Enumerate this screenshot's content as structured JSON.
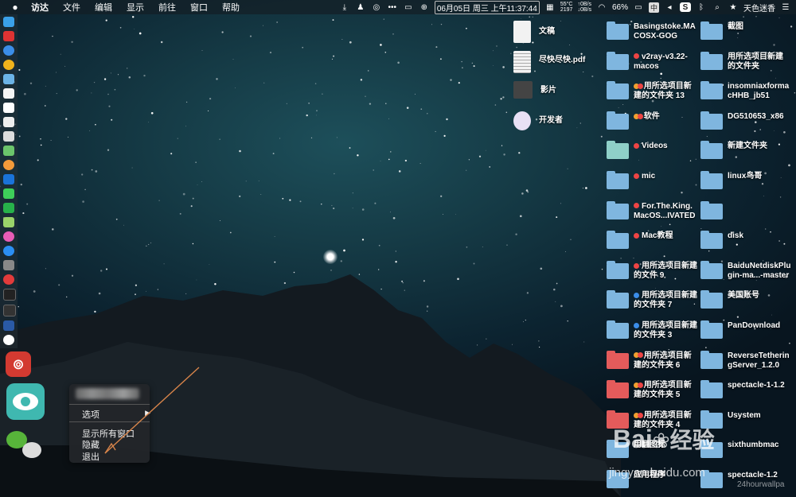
{
  "menubar": {
    "app_name": "访达",
    "menus": [
      "文件",
      "编辑",
      "显示",
      "前往",
      "窗口",
      "帮助"
    ],
    "cpu_temp": "55°C",
    "cpu_rpm": "2197",
    "net_up": "↑0B/s",
    "net_down": "↓0B/s",
    "datetime": "06月05日 周三 上午11:37:44",
    "battery": "66%",
    "input_method": "中",
    "user": "天色迷香"
  },
  "context_menu": {
    "options_label": "选项",
    "show_all_windows": "显示所有窗口",
    "hide": "隐藏",
    "quit": "退出"
  },
  "desktop_files": [
    {
      "label": "文稿"
    },
    {
      "label": "尽快尽快.pdf"
    },
    {
      "label": "影片"
    },
    {
      "label": "开发者"
    }
  ],
  "desktop_folders_col1": [
    {
      "l1": "Basingstoke.MA",
      "l2": "COSX-GOG"
    },
    {
      "l1": "v2ray-v3.22-",
      "l2": "macos"
    },
    {
      "l1": "用所选项目新",
      "l2": "建的文件夹 13"
    },
    {
      "l1": "软件",
      "l2": ""
    },
    {
      "l1": "Videos",
      "l2": ""
    },
    {
      "l1": "mic",
      "l2": ""
    },
    {
      "l1": "For.The.King.",
      "l2": "MacOS...IVATED"
    },
    {
      "l1": "Mac教程",
      "l2": ""
    },
    {
      "l1": "用所选项目新建",
      "l2": "的文件 9"
    },
    {
      "l1": "用所选项目新建",
      "l2": "的文件夹 7"
    },
    {
      "l1": "用所选项目新建",
      "l2": "的文件夹 3"
    },
    {
      "l1": "用所选项目新",
      "l2": "建的文件夹 6"
    },
    {
      "l1": "用所选项目新",
      "l2": "建的文件夹 5"
    },
    {
      "l1": "用所选项目新",
      "l2": "建的文件夹 4"
    },
    {
      "l1": "用翻图标",
      "l2": ""
    },
    {
      "l1": "应用程序",
      "l2": ""
    }
  ],
  "desktop_folders_col2": [
    {
      "l1": "截图",
      "l2": ""
    },
    {
      "l1": "用所选项目新建",
      "l2": "的文件夹"
    },
    {
      "l1": "insomniaxforma",
      "l2": "cHHB_jb51"
    },
    {
      "l1": "DG510653_x86",
      "l2": ""
    },
    {
      "l1": "新建文件夹",
      "l2": ""
    },
    {
      "l1": "linux鸟哥",
      "l2": ""
    },
    {
      "l1": "",
      "l2": ""
    },
    {
      "l1": "disk",
      "l2": ""
    },
    {
      "l1": "BaiduNetdiskPlu",
      "l2": "gin-ma...-master"
    },
    {
      "l1": "美国账号",
      "l2": ""
    },
    {
      "l1": "PanDownload",
      "l2": ""
    },
    {
      "l1": "ReverseTetherin",
      "l2": "gServer_1.2.0"
    },
    {
      "l1": "spectacle-1-1.2",
      "l2": ""
    },
    {
      "l1": "Usystem",
      "l2": ""
    },
    {
      "l1": "sixthumbmac",
      "l2": ""
    },
    {
      "l1": "spectacle-1.2",
      "l2": ""
    }
  ],
  "watermark": {
    "brand": "Bai",
    "brand2": "经验",
    "url": "jingyan.baidu.com",
    "corner": "24hourwallpa"
  }
}
